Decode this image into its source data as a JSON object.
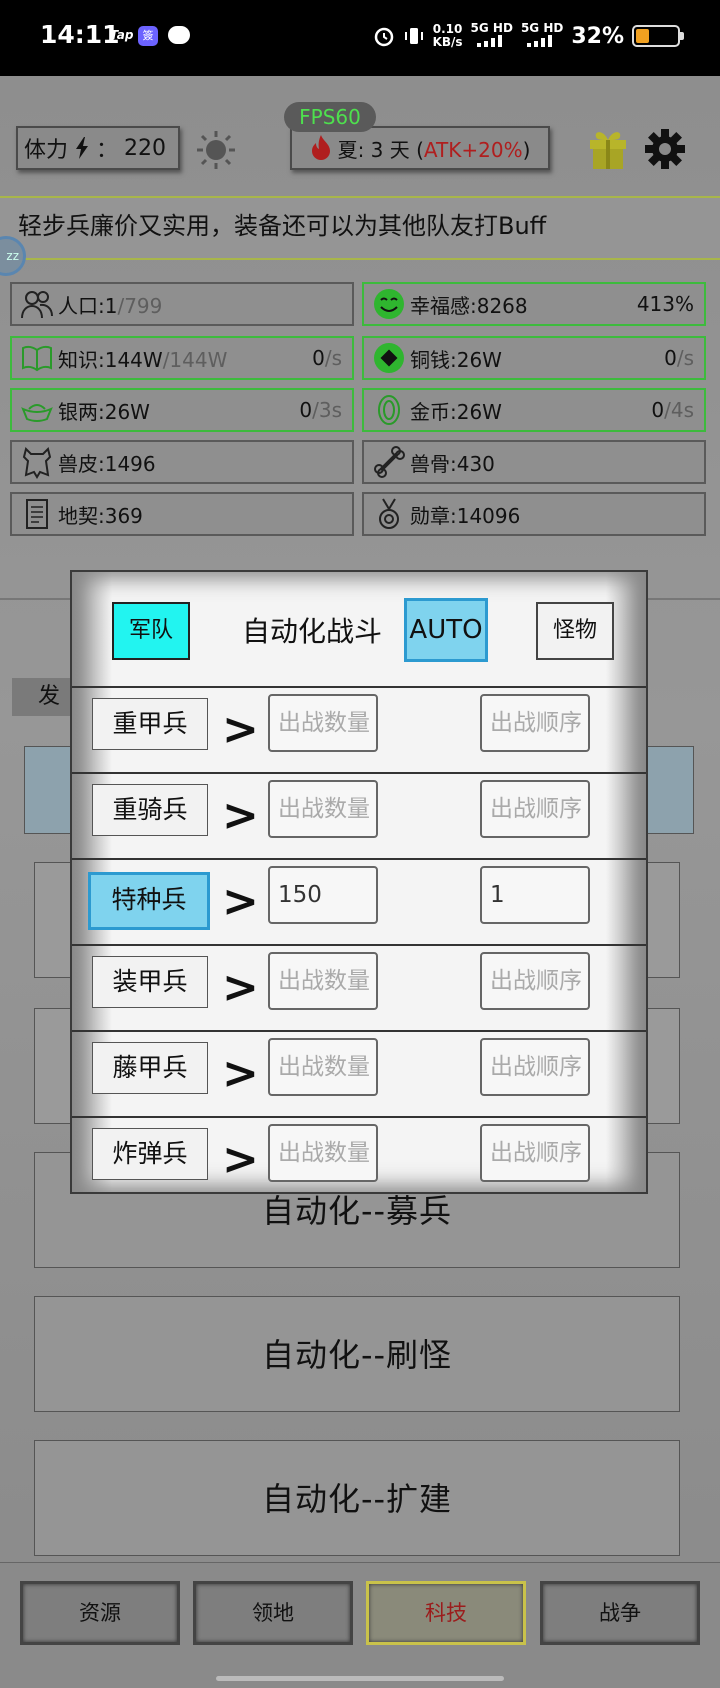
{
  "status_bar": {
    "time": "14:11",
    "tap_label": "Tap",
    "app_badge": "簽",
    "net_speed_value": "0.10",
    "net_speed_unit": "KB/s",
    "sim1": "5G HD",
    "sim2": "5G HD",
    "battery_percent": "32%",
    "battery_level": 0.32
  },
  "hud": {
    "fps": "FPS60",
    "stamina_label": "体力",
    "stamina_sep": "：",
    "stamina_value": "220",
    "season_text": "夏: 3 天 (",
    "season_atk": "ATK+20%",
    "season_close": ")",
    "tip": "轻步兵廉价又实用，装备还可以为其他队友打Buff",
    "tip_badge": "zz"
  },
  "resources": [
    {
      "icon": "people-icon",
      "label": "人口:1",
      "dim": "/799",
      "rate": "",
      "rate_dim": "",
      "green": false
    },
    {
      "icon": "smile-icon",
      "label": "幸福感:8268",
      "dim": "",
      "rate": "413%",
      "rate_dim": "",
      "green": true
    },
    {
      "icon": "book-icon",
      "label": "知识:144W",
      "dim": "/144W",
      "rate": "0",
      "rate_dim": "/s",
      "green": true
    },
    {
      "icon": "coin-icon",
      "label": "铜钱:26W",
      "dim": "",
      "rate": "0",
      "rate_dim": "/s",
      "green": true
    },
    {
      "icon": "silver-ingot-icon",
      "label": "银两:26W",
      "dim": "",
      "rate": "0",
      "rate_dim": "/3s",
      "green": true
    },
    {
      "icon": "gold-coin-icon",
      "label": "金币:26W",
      "dim": "",
      "rate": "0",
      "rate_dim": "/4s",
      "green": true
    },
    {
      "icon": "hide-icon",
      "label": "兽皮:1496",
      "dim": "",
      "rate": "",
      "rate_dim": "",
      "green": false
    },
    {
      "icon": "bone-icon",
      "label": "兽骨:430",
      "dim": "",
      "rate": "",
      "rate_dim": "",
      "green": false
    },
    {
      "icon": "scroll-icon",
      "label": "地契:369",
      "dim": "",
      "rate": "",
      "rate_dim": "",
      "green": false
    },
    {
      "icon": "medal-icon",
      "label": "勋章:14096",
      "dim": "",
      "rate": "",
      "rate_dim": "",
      "green": false
    }
  ],
  "background": {
    "tab_dev": "发展",
    "auto_recruit": "自动化--募兵",
    "auto_farm": "自动化--刷怪",
    "auto_expand": "自动化--扩建"
  },
  "modal": {
    "army_tab": "军队",
    "title": "自动化战斗",
    "auto_button": "AUTO",
    "monster_tab": "怪物",
    "chevron": ">",
    "units": [
      {
        "name": "重甲兵",
        "qty_value": "",
        "qty_placeholder": "出战数量",
        "order_value": "",
        "order_placeholder": "出战顺序",
        "selected": false
      },
      {
        "name": "重骑兵",
        "qty_value": "",
        "qty_placeholder": "出战数量",
        "order_value": "",
        "order_placeholder": "出战顺序",
        "selected": false
      },
      {
        "name": "特种兵",
        "qty_value": "150",
        "qty_placeholder": "出战数量",
        "order_value": "1",
        "order_placeholder": "出战顺序",
        "selected": true
      },
      {
        "name": "装甲兵",
        "qty_value": "",
        "qty_placeholder": "出战数量",
        "order_value": "",
        "order_placeholder": "出战顺序",
        "selected": false
      },
      {
        "name": "藤甲兵",
        "qty_value": "",
        "qty_placeholder": "出战数量",
        "order_value": "",
        "order_placeholder": "出战顺序",
        "selected": false
      },
      {
        "name": "炸弹兵",
        "qty_value": "",
        "qty_placeholder": "出战数量",
        "order_value": "",
        "order_placeholder": "出战顺序",
        "selected": false
      }
    ]
  },
  "bottom_nav": [
    {
      "label": "资源",
      "active": false
    },
    {
      "label": "领地",
      "active": false
    },
    {
      "label": "科技",
      "active": true
    },
    {
      "label": "战争",
      "active": false
    }
  ],
  "colors": {
    "fps_green": "#4ee04e",
    "atk_red": "#b01e1e",
    "selected_blue": "#7fd3ee",
    "army_cyan": "#22f4f0",
    "resource_green_border": "#3dbb3d",
    "active_nav_border": "#c9c24a"
  }
}
